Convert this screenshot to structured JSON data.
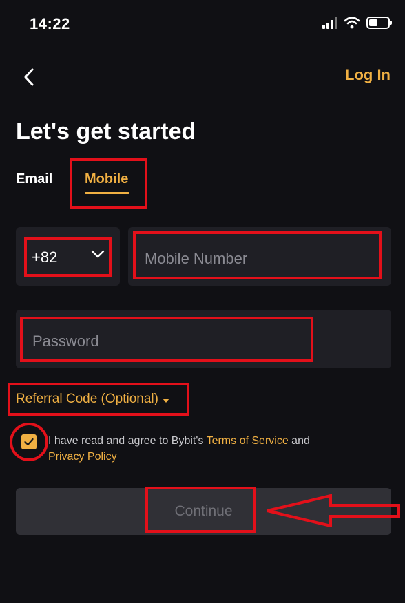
{
  "status_bar": {
    "time": "14:22",
    "icons": [
      "signal-icon",
      "wifi-icon",
      "battery-icon"
    ]
  },
  "header": {
    "back_icon": "back-chevron-icon",
    "login_label": "Log In"
  },
  "title": "Let's get started",
  "tabs": [
    {
      "label": "Email",
      "active": false
    },
    {
      "label": "Mobile",
      "active": true
    }
  ],
  "form": {
    "country_code": "+82",
    "country_icon": "chevron-down-icon",
    "mobile_placeholder": "Mobile Number",
    "password_placeholder": "Password",
    "referral_label": "Referral Code (Optional)"
  },
  "agreement": {
    "checked": true,
    "prefix": "I have read and agree to Bybit's ",
    "terms_label": "Terms of Service",
    "middle": " and",
    "privacy_label": "Privacy Policy"
  },
  "continue_label": "Continue",
  "colors": {
    "background": "#101014",
    "field": "#1f1f25",
    "accent": "#f0b043",
    "annotation": "#e3101a",
    "button_disabled": "#303036"
  }
}
